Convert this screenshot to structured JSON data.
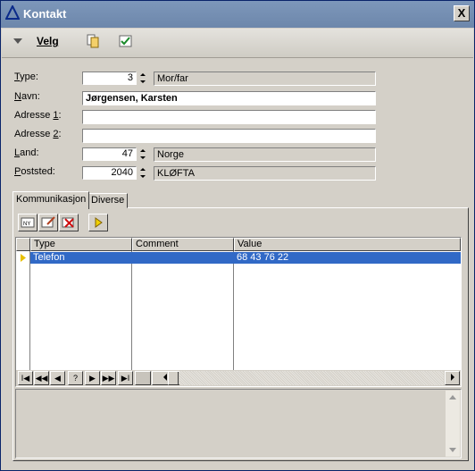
{
  "window": {
    "title": "Kontakt",
    "close_label": "X"
  },
  "toolbar": {
    "velg_label": "Velg",
    "icons": [
      "dropdown-arrow-icon",
      "copy-icon",
      "checklist-icon"
    ]
  },
  "form": {
    "type": {
      "label_prefix": "",
      "label_ul": "T",
      "label_rest": "ype:",
      "value": "3",
      "text": "Mor/far"
    },
    "navn": {
      "label_ul": "N",
      "label_rest": "avn:",
      "value": "Jørgensen, Karsten"
    },
    "adresse1": {
      "label_prefix": "Adresse ",
      "label_ul": "1",
      "label_rest": ":",
      "value": ""
    },
    "adresse2": {
      "label_prefix": "Adresse ",
      "label_ul": "2",
      "label_rest": ":",
      "value": ""
    },
    "land": {
      "label_ul": "L",
      "label_rest": "and:",
      "value": "47",
      "text": "Norge"
    },
    "poststed": {
      "label_ul": "P",
      "label_rest": "oststed:",
      "value": "2040",
      "text": "KLØFTA"
    }
  },
  "tabs": [
    {
      "label": "Kommunikasjon",
      "active": true
    },
    {
      "label": "Diverse",
      "active": false
    }
  ],
  "grid": {
    "columns": [
      "Type",
      "Comment",
      "Value"
    ],
    "rows": [
      {
        "type": "Telefon",
        "comment": "",
        "value": "68 43 76 22",
        "selected": true
      }
    ]
  },
  "navigator": {
    "buttons": [
      "I◀",
      "◀◀",
      "◀",
      "?",
      "▶",
      "▶▶",
      "▶I"
    ]
  },
  "colors": {
    "title_bar": "#7d97ba",
    "selection": "#3169c6",
    "face": "#d4d0c8"
  }
}
